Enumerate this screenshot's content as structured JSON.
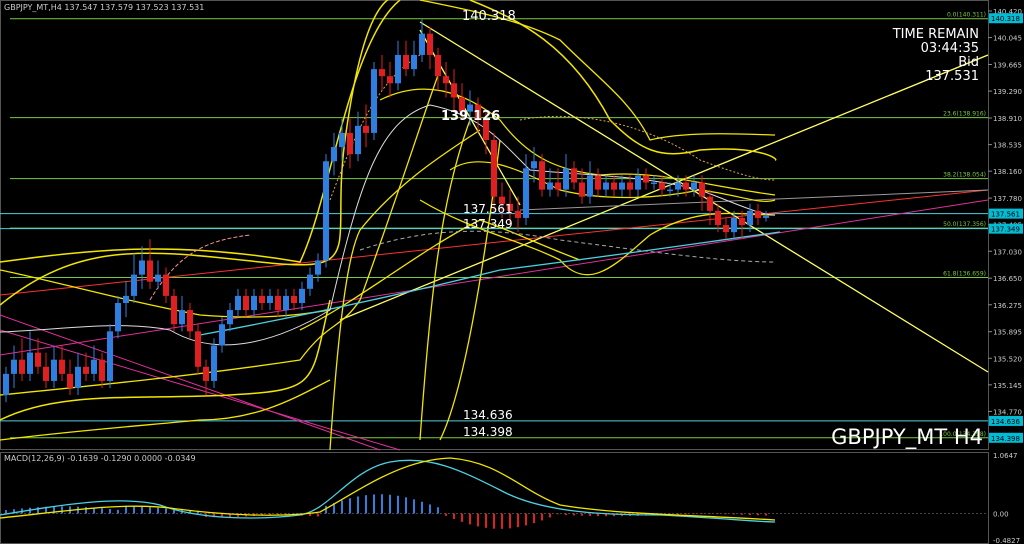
{
  "main_header": "GBPJPY_MT,H4  137.547 137.579 137.523 137.531",
  "symbol_watermark": "GBPJPY_MT H4",
  "timer": {
    "line1": "TIME REMAIN",
    "line2": "03:44:35",
    "line3": "Bid",
    "line4": "137.531"
  },
  "annotations": {
    "high": "140.318",
    "mid": "139.126",
    "a": "137.561",
    "b": "137.349",
    "c": "134.636",
    "d": "134.398"
  },
  "fib_labels": [
    "0.0(140.311)",
    "23.6(138.916)",
    "38.2(138.054)",
    "50.0(137.356)",
    "61.8(136.659)",
    "100.0(134.398)"
  ],
  "fib_values": [
    140.311,
    138.916,
    138.054,
    137.356,
    136.659,
    134.398
  ],
  "price_axis": [
    "140.420",
    "140.045",
    "139.665",
    "139.290",
    "138.910",
    "138.535",
    "138.160",
    "137.780",
    "137.405",
    "137.030",
    "136.650",
    "136.275",
    "135.895",
    "135.520",
    "135.145",
    "134.770",
    "134.395"
  ],
  "price_axis_values": [
    140.42,
    140.045,
    139.665,
    139.29,
    138.91,
    138.535,
    138.16,
    137.78,
    137.405,
    137.03,
    136.65,
    136.275,
    135.895,
    135.52,
    135.145,
    134.77,
    134.395
  ],
  "axis_tags": [
    {
      "text": "140.318",
      "value": 140.318,
      "color": "#00bcd4"
    },
    {
      "text": "137.561",
      "value": 137.561,
      "color": "#00bcd4"
    },
    {
      "text": "137.349",
      "value": 137.349,
      "color": "#00bcd4"
    },
    {
      "text": "134.636",
      "value": 134.636,
      "color": "#00bcd4"
    },
    {
      "text": "134.398",
      "value": 134.398,
      "color": "#00bcd4"
    }
  ],
  "macd_header": "MACD(12,26,9) -0.1639 -0.1290 0.0000 -0.0349",
  "macd_axis": [
    "1.0647",
    "0.00",
    "-0.4827"
  ],
  "colors": {
    "up": "#2f7fe0",
    "down": "#e02020",
    "fib": "#7ac943",
    "ma": "#ffd700",
    "line": "#ffff66",
    "cyan": "#4dd0e1",
    "magenta": "#e0309a",
    "red": "#ff3030",
    "grid": "#1a1a1a"
  }
}
